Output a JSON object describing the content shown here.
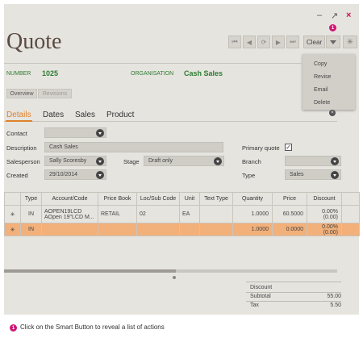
{
  "window": {
    "minimize": "–",
    "maximize": "↗",
    "close": "×"
  },
  "title": "Quote",
  "toolbar": {
    "clear_label": "Clear",
    "callout": "1"
  },
  "smart_menu": {
    "items": [
      "Copy",
      "Revise",
      "Email",
      "Delete"
    ]
  },
  "header": {
    "number_label": "NUMBER",
    "number_value": "1025",
    "organisation_label": "ORGANISATION",
    "organisation_value": "Cash Sales"
  },
  "subtabs": [
    "Overview",
    "Revisions"
  ],
  "tabs": [
    "Details",
    "Dates",
    "Sales",
    "Product"
  ],
  "form": {
    "contact_label": "Contact",
    "contact_value": "",
    "description_label": "Description",
    "description_value": "Cash Sales",
    "salesperson_label": "Salesperson",
    "salesperson_value": "Sally Scoresby",
    "stage_label": "Stage",
    "stage_value": "Draft only",
    "created_label": "Created",
    "created_value": "29/10/2014",
    "primary_quote_label": "Primary quote",
    "primary_quote_checked": "✓",
    "branch_label": "Branch",
    "branch_value": "",
    "type_label": "Type",
    "type_value": "Sales"
  },
  "grid": {
    "columns": [
      "",
      "Type",
      "Account/Code",
      "Price Book",
      "Loc/Sub Code",
      "Unit",
      "Text Type",
      "Quantity",
      "Price",
      "Discount"
    ],
    "rows": [
      {
        "icon": "✳",
        "type": "IN",
        "account1": "AOPEN19LCD",
        "account2": "AOpen 19\"LCD M...",
        "price_book": "RETAIL",
        "loc": "02",
        "unit": "EA",
        "text_type": "",
        "quantity": "1.0000",
        "price": "60.5000",
        "discount1": "0.00%",
        "discount2": "(0.00)"
      },
      {
        "icon": "✳",
        "type": "IN",
        "account1": "",
        "account2": "",
        "price_book": "",
        "loc": "",
        "unit": "",
        "text_type": "",
        "quantity": "1.0000",
        "price": "0.0000",
        "discount1": "0.00%",
        "discount2": "(0.00)"
      }
    ]
  },
  "summary": {
    "discount_label": "Discount",
    "discount_value": "",
    "subtotal_label": "Subtotal",
    "subtotal_value": "55.00",
    "tax_label": "Tax",
    "tax_value": "5.50"
  },
  "caption": {
    "number": "1",
    "text": "Click on the Smart Button to reveal a list of actions"
  },
  "colors": {
    "accent": "#e0812a",
    "brand_green": "#2e7d32",
    "callout": "#d11675",
    "selected_row": "#f2b07a"
  }
}
